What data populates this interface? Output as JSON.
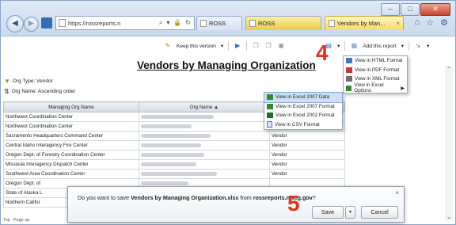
{
  "browser": {
    "address": "https://rossreports.n",
    "tabs": [
      {
        "label": "ROSS"
      },
      {
        "label": "ROSS"
      },
      {
        "label": "Vendors by Man..."
      }
    ],
    "tab_close_glyph": "×",
    "window_buttons": {
      "minimize": "–",
      "maximize": "□",
      "close": "✕"
    },
    "right_icons": [
      "⌂",
      "☆",
      "⚙"
    ],
    "address_icons": [
      "⌕",
      "▾",
      "🔒",
      "↻"
    ],
    "back_glyph": "◀",
    "fwd_glyph": "▶"
  },
  "toolbar": {
    "keep_version": "Keep this version",
    "add_report": "Add this report",
    "dropdown_glyph": "▾"
  },
  "report": {
    "title": "Vendors by Managing Organization",
    "org_type": "Org Type: Vendor",
    "org_name": "Org Name: Ascending order",
    "columns": [
      "Managing Org Name",
      "Org Name ▲",
      ""
    ],
    "rows": [
      {
        "managing": "Northwest Coordination Center",
        "type": ""
      },
      {
        "managing": "Northwest Coordination Center",
        "type": ""
      },
      {
        "managing": "Sacramento Headquarters Command Center",
        "type": "Vendor"
      },
      {
        "managing": "Central Idaho Interagency Fire Center",
        "type": "Vendor"
      },
      {
        "managing": "Oregon Dept. of Forestry Coordination Center",
        "type": "Vendor"
      },
      {
        "managing": "Missoula Interagency Dispatch Center",
        "type": "Vendor"
      },
      {
        "managing": "Southwest Area Coordination Center",
        "type": "Vendor"
      },
      {
        "managing": "Oregon Dept. of",
        "type": ""
      },
      {
        "managing": "State of Alaska L",
        "type": ""
      },
      {
        "managing": "Northern Califor",
        "type": ""
      }
    ]
  },
  "export_menu": {
    "items": [
      {
        "label": "View in HTML Format",
        "icon": "html-icon"
      },
      {
        "label": "View in PDF Format",
        "icon": "pdf-icon"
      },
      {
        "label": "View in XML Format",
        "icon": "xml-icon"
      },
      {
        "label": "View in Excel Options",
        "icon": "excel-icon"
      }
    ]
  },
  "excel_submenu": {
    "items": [
      {
        "label": "View in Excel 2007 Data"
      },
      {
        "label": "View in Excel 2007 Format"
      },
      {
        "label": "View in Excel 2002 Format"
      },
      {
        "label": "View in CSV Format"
      }
    ]
  },
  "steps": {
    "four": "4",
    "five": "5"
  },
  "download": {
    "prefix": "Do you want to save ",
    "filename": "Vendors by Managing Organization.xlsx",
    "middle": " from ",
    "host": "rossreports.nwcg.gov",
    "suffix": "?",
    "save": "Save",
    "dropdown": "▾",
    "cancel": "Cancel",
    "close": "×"
  },
  "status": {
    "top": "Top",
    "page_up": "Page up"
  },
  "colors": {
    "accent": "#e0321f"
  }
}
